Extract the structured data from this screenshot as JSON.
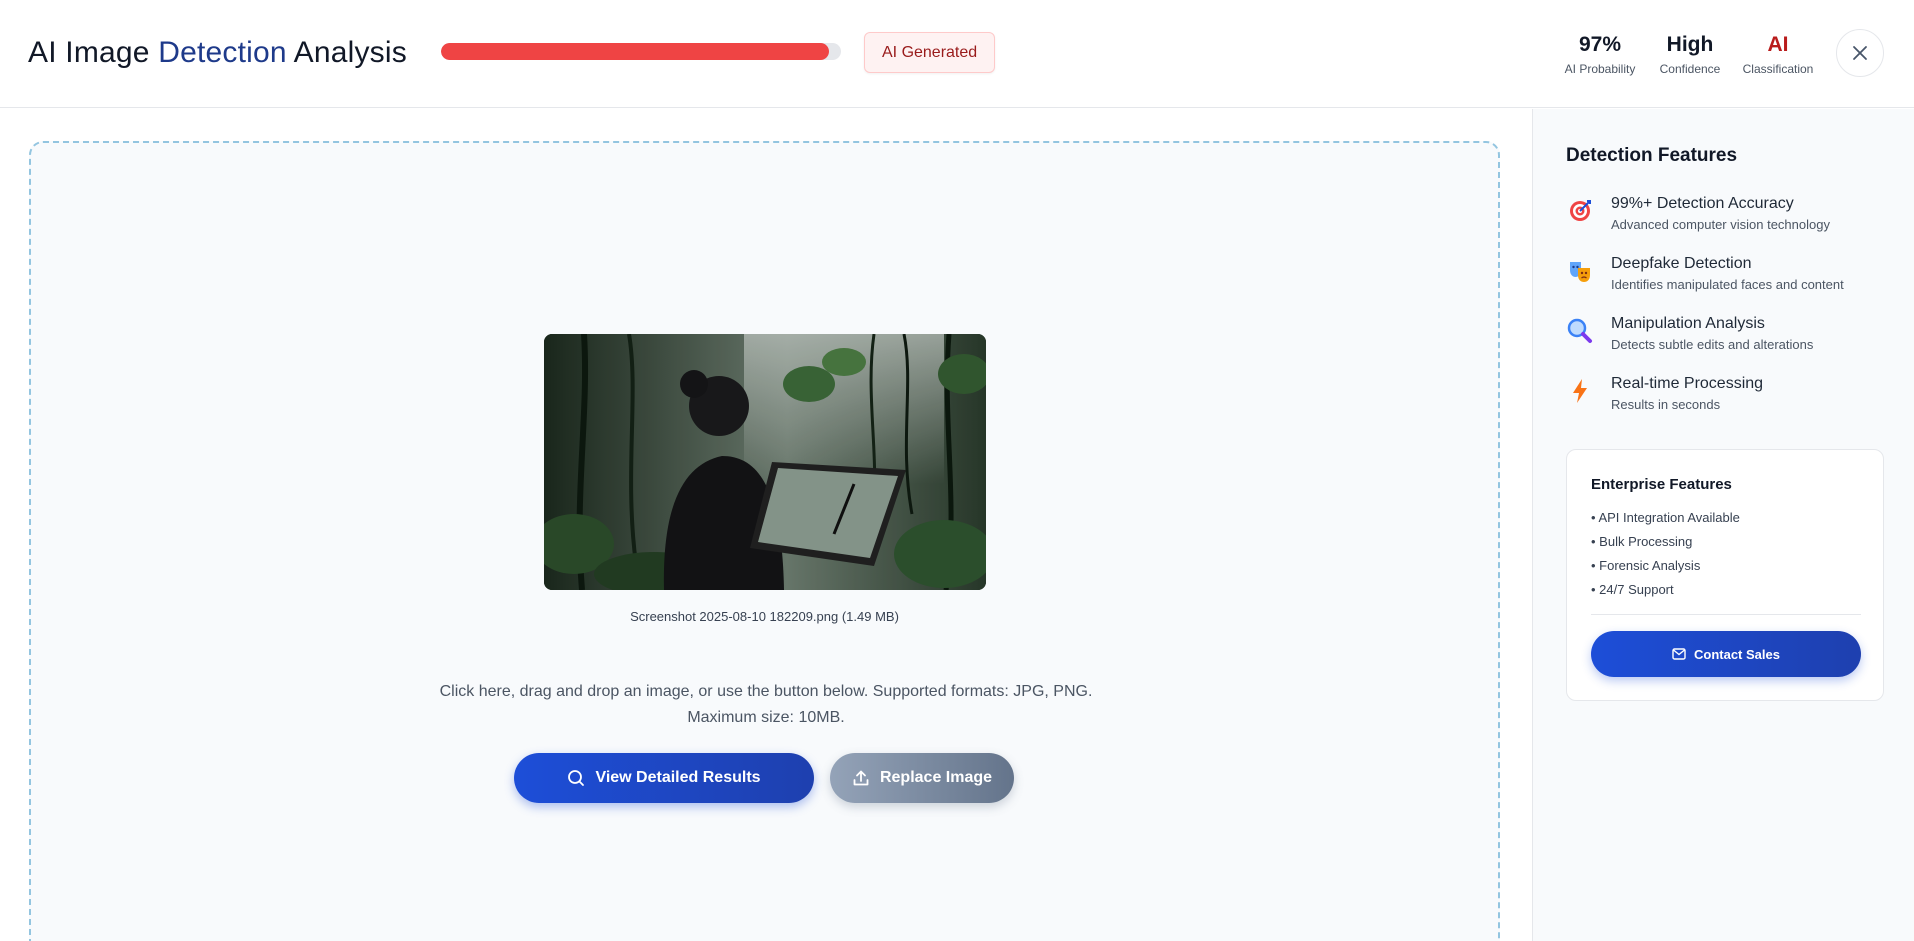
{
  "header": {
    "title_prefix": "AI Image ",
    "title_accent": "Detection",
    "title_suffix": " Analysis",
    "progress_fraction": 0.97,
    "progress_color": "#ef4444",
    "result_badge": "AI Generated",
    "stats": {
      "probability_value": "97%",
      "probability_label": "AI Probability",
      "confidence_value": "High",
      "confidence_label": "Confidence",
      "classification_value": "AI",
      "classification_label": "Classification"
    },
    "close_icon": "close-icon"
  },
  "upload": {
    "file_name": "Screenshot 2025-08-10 182209.png (1.49 MB)",
    "hint_line1": "Click here, drag and drop an image, or use the button below. Supported formats: JPG, PNG.",
    "hint_line2": "Maximum size: 10MB.",
    "view_button_label": "View Detailed Results",
    "view_button_icon": "search-icon",
    "replace_button_label": "Replace Image",
    "replace_button_icon": "upload-icon"
  },
  "sidebar": {
    "title": "Detection Features",
    "features": [
      {
        "icon": "target-icon",
        "name": "99%+ Detection Accuracy",
        "description": "Advanced computer vision technology"
      },
      {
        "icon": "masks-icon",
        "name": "Deepfake Detection",
        "description": "Identifies manipulated faces and content"
      },
      {
        "icon": "magnifier-icon",
        "name": "Manipulation Analysis",
        "description": "Detects subtle edits and alterations"
      },
      {
        "icon": "lightning-icon",
        "name": "Real-time Processing",
        "description": "Results in seconds"
      }
    ],
    "enterprise": {
      "title": "Enterprise Features",
      "items": [
        "• API Integration Available",
        "• Bulk Processing",
        "• Forensic Analysis",
        "• 24/7 Support"
      ],
      "contact_label": "Contact Sales",
      "contact_icon": "mail-icon"
    }
  },
  "colors": {
    "brand_blue": "#1d4ed8",
    "danger_red": "#ef4444",
    "badge_text": "#991b1b"
  }
}
